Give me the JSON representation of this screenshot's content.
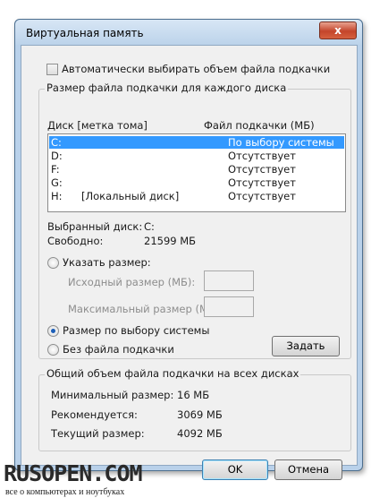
{
  "window": {
    "title": "Виртуальная память",
    "close_label": "x"
  },
  "auto_manage": {
    "label": "Автоматически выбирать объем файла подкачки",
    "checked": false
  },
  "per_drive": {
    "group_title": "Размер файла подкачки для каждого диска",
    "columns": [
      "Диск [метка тома]",
      "Файл подкачки (МБ)"
    ],
    "drives": [
      {
        "drive": "C:",
        "label": "",
        "size": "По выбору системы",
        "selected": true
      },
      {
        "drive": "D:",
        "label": "",
        "size": "Отсутствует",
        "selected": false
      },
      {
        "drive": "F:",
        "label": "",
        "size": "Отсутствует",
        "selected": false
      },
      {
        "drive": "G:",
        "label": "",
        "size": "Отсутствует",
        "selected": false
      },
      {
        "drive": "H:",
        "label": "[Локальный диск]",
        "size": "Отсутствует",
        "selected": false
      }
    ],
    "selected_drive_label": "Выбранный диск:",
    "selected_drive_value": "C:",
    "free_label": "Свободно:",
    "free_value": "21599 МБ",
    "custom_size_label": "Указать размер:",
    "initial_size_label": "Исходный размер (МБ):",
    "initial_size_value": "",
    "max_size_label": "Максимальный размер (МБ):",
    "max_size_value": "",
    "system_managed_label": "Размер по выбору системы",
    "no_paging_label": "Без файла подкачки",
    "selected_option": "system_managed",
    "set_button": "Задать"
  },
  "totals": {
    "group_title": "Общий объем файла подкачки на всех дисках",
    "min_label": "Минимальный размер:",
    "min_value": "16 МБ",
    "recommended_label": "Рекомендуется:",
    "recommended_value": "3069 МБ",
    "current_label": "Текущий размер:",
    "current_value": "4092 МБ"
  },
  "buttons": {
    "ok": "OK",
    "cancel": "Отмена"
  },
  "watermark": {
    "title": "RUSOPEN.COM",
    "subtitle": "все о компьютерах и ноутбуках"
  },
  "colors": {
    "selection": "#3399ff",
    "frame": "#b9d1ea"
  }
}
